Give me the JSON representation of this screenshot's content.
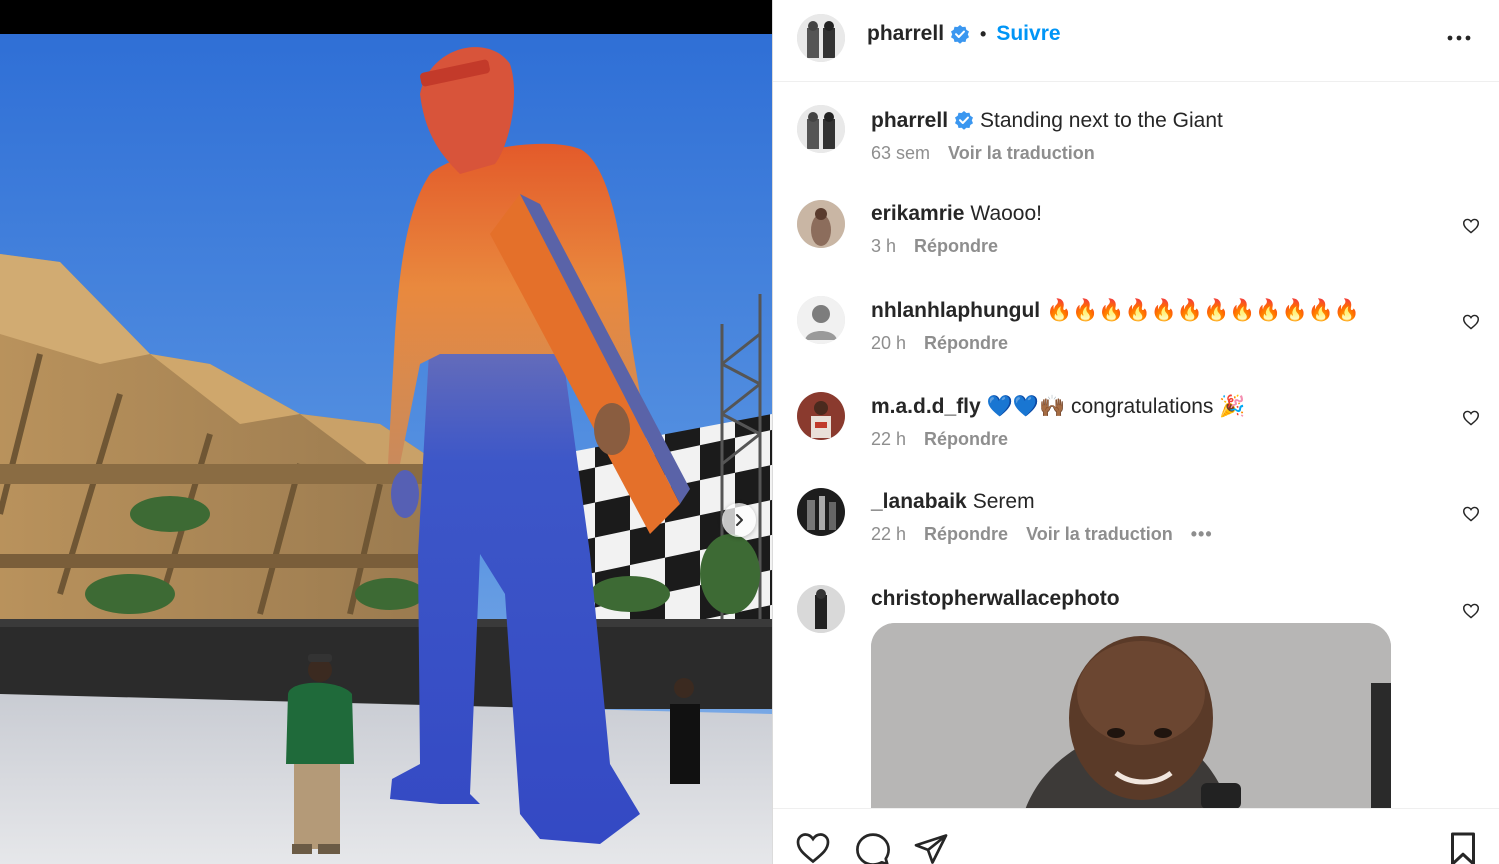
{
  "post": {
    "username": "pharrell",
    "follow_label": "Suivre",
    "separator": "•",
    "caption_text": "Standing next to the Giant",
    "caption_time": "63 sem",
    "translate_label": "Voir la traduction"
  },
  "comments": [
    {
      "username": "erikamrie",
      "text": "Waooo!",
      "time": "3 h",
      "reply": "Répondre"
    },
    {
      "username": "nhlanhlaphungul",
      "text": "🔥🔥🔥🔥🔥🔥🔥🔥🔥🔥🔥🔥",
      "time": "20 h",
      "reply": "Répondre"
    },
    {
      "username": "m.a.d.d_fly",
      "emoji_prefix": "💙💙🙌🏾",
      "text": "congratulations",
      "emoji_suffix": "🎉",
      "time": "22 h",
      "reply": "Répondre"
    },
    {
      "username": "_lanabaik",
      "text": "Serem",
      "time": "22 h",
      "reply": "Répondre",
      "translate": "Voir la traduction",
      "more": "•••"
    },
    {
      "username": "christopherwallacephoto"
    }
  ],
  "icons": {
    "more": "more-horizontal-icon",
    "verified": "verified-badge-icon",
    "like": "heart-icon",
    "comment": "comment-icon",
    "share": "paper-plane-icon",
    "save": "bookmark-icon",
    "carousel_next": "chevron-right-icon"
  },
  "colors": {
    "accent": "#0095f6",
    "text": "#262626",
    "muted": "#8e8e8e",
    "sky": "#3f7fd8",
    "statue_blue": "#3a55c9",
    "statue_orange": "#e9772e"
  }
}
